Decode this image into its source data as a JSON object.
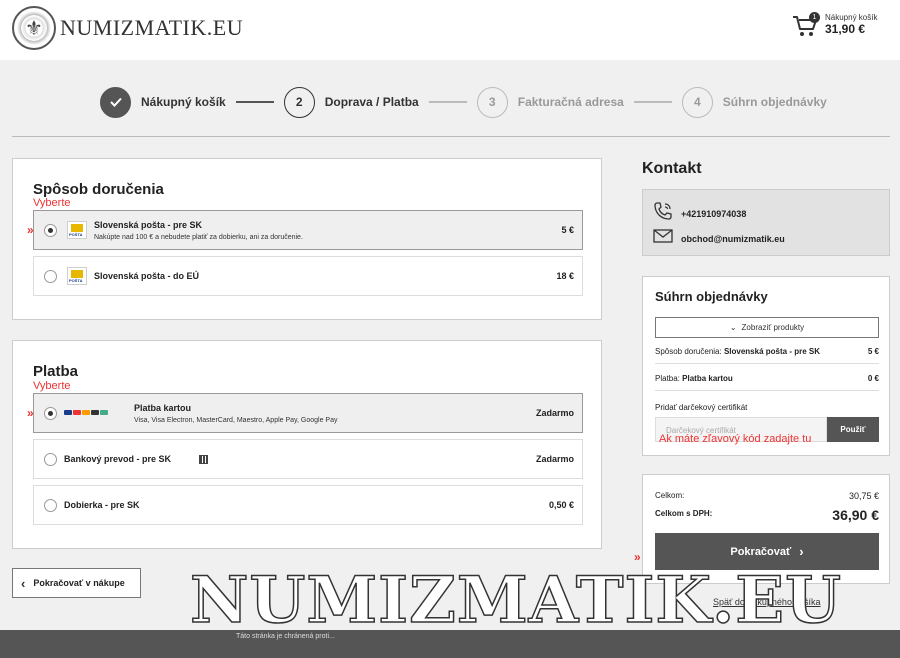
{
  "header": {
    "logo_text": "NUMIZMATIK.EU",
    "cart_count": "1",
    "cart_label": "Nákupný košík",
    "cart_total": "31,90 €"
  },
  "steps": [
    {
      "num": "",
      "label": "Nákupný košík",
      "state": "done"
    },
    {
      "num": "2",
      "label": "Doprava / Platba",
      "state": "active"
    },
    {
      "num": "3",
      "label": "Fakturačná adresa",
      "state": "future"
    },
    {
      "num": "4",
      "label": "Súhrn objednávky",
      "state": "future"
    }
  ],
  "delivery": {
    "title": "Spôsob doručenia",
    "hint": "Vyberte",
    "options": [
      {
        "title": "Slovenská pošta - pre SK",
        "subtitle": "Nakúpte nad 100 € a nebudete platiť za dobierku, ani za doručenie.",
        "price": "5 €",
        "selected": true
      },
      {
        "title": "Slovenská pošta - do EÚ",
        "subtitle": "",
        "price": "18 €",
        "selected": false
      }
    ]
  },
  "payment": {
    "title": "Platba",
    "hint": "Vyberte",
    "options": [
      {
        "title": "Platba kartou",
        "subtitle": "Visa, Visa Electron, MasterCard, Maestro, Apple Pay, Google Pay",
        "price": "Zadarmo",
        "selected": true
      },
      {
        "title": "Bankový prevod - pre SK",
        "subtitle": "",
        "price": "Zadarmo",
        "selected": false
      },
      {
        "title": "Dobierka - pre SK",
        "subtitle": "",
        "price": "0,50 €",
        "selected": false
      }
    ]
  },
  "back_button": "Pokračovať v nákupe",
  "contact": {
    "title": "Kontakt",
    "phone": "+421910974038",
    "email": "obchod@numizmatik.eu",
    "phone_icon": "phone-icon",
    "email_icon": "envelope-icon"
  },
  "summary": {
    "title": "Súhrn objednávky",
    "show_products": "Zobraziť produkty",
    "delivery_label": "Spôsob doručenia:",
    "delivery_value": "Slovenská pošta - pre SK",
    "delivery_price": "5 €",
    "payment_label": "Platba:",
    "payment_value": "Platba kartou",
    "payment_price": "0 €",
    "gift_label": "Pridať darčekový certifikát",
    "gift_placeholder": "Darčekový certifikát",
    "gift_apply": "Použiť",
    "gift_hint": "Ak máte zľavový kód zadajte tu"
  },
  "totals": {
    "total_label": "Celkom:",
    "total_value": "30,75 €",
    "total_vat_label": "Celkom s DPH:",
    "total_vat_value": "36,90 €",
    "continue": "Pokračovať",
    "back_link": "Späť do nákupného košíka"
  },
  "footer": {
    "text": "Táto stránka je chránená proti..."
  },
  "watermark": "NUMIZMATIK.EU",
  "colors": {
    "accent_red": "#e33333",
    "dark_button": "#555555"
  }
}
